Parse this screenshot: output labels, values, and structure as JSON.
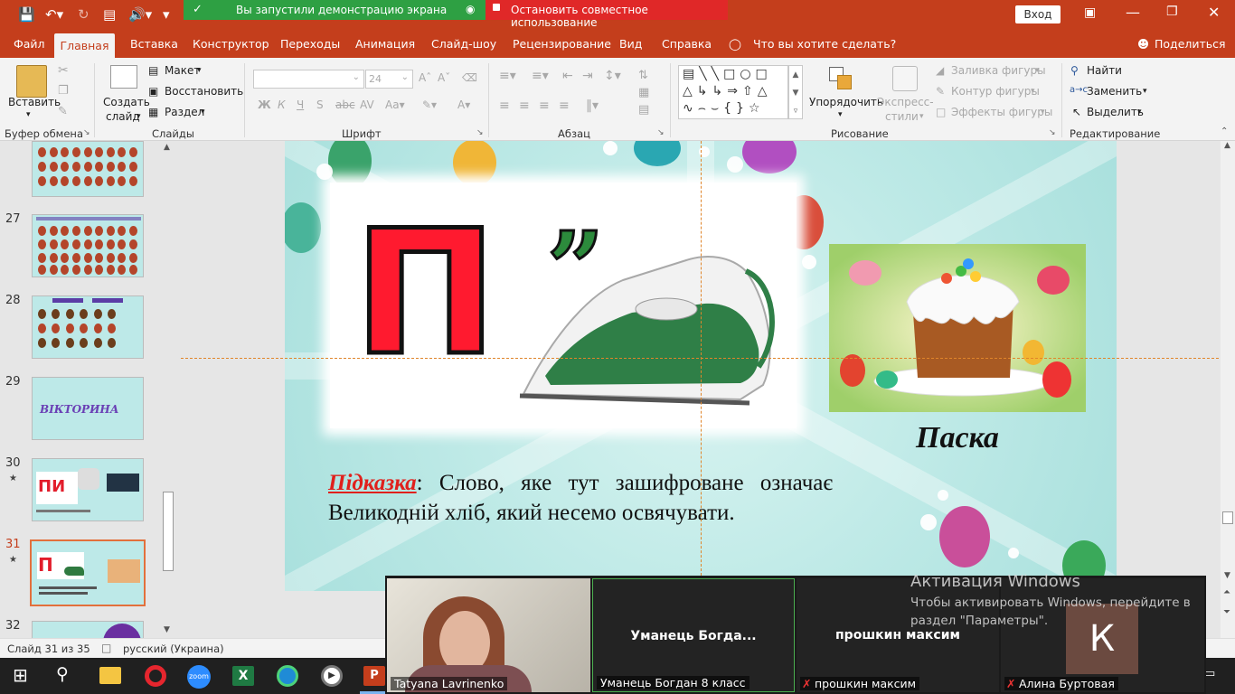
{
  "titlebar": {
    "share_banner": "Вы запустили демонстрацию экрана",
    "stop_sharing": "Остановить совместное использование",
    "login": "Вход"
  },
  "tabs": [
    "Файл",
    "Главная",
    "Вставка",
    "Конструктор",
    "Переходы",
    "Анимация",
    "Слайд-шоу",
    "Рецензирование",
    "Вид",
    "Справка"
  ],
  "tell_me": "Что вы хотите сделать?",
  "share": "Поделиться",
  "ribbon": {
    "paste": "Вставить",
    "clipboard": "Буфер обмена",
    "new_slide_1": "Создать",
    "new_slide_2": "слайд",
    "layout": "Макет",
    "reset": "Восстановить",
    "section": "Раздел",
    "slides": "Слайды",
    "font_size": "24",
    "font": "Шрифт",
    "paragraph": "Абзац",
    "arrange": "Упорядочить",
    "quick_styles_1": "Экспресс-",
    "quick_styles_2": "стили",
    "shape_fill": "Заливка фигуры",
    "shape_outline": "Контур фигуры",
    "shape_effects": "Эффекты фигуры",
    "drawing": "Рисование",
    "find": "Найти",
    "replace": "Заменить",
    "select": "Выделить",
    "editing": "Редактирование"
  },
  "thumbnails": [
    {
      "num": "27",
      "star": ""
    },
    {
      "num": "28",
      "star": ""
    },
    {
      "num": "29",
      "star": "",
      "text": "ВІКТОРИНА"
    },
    {
      "num": "30",
      "star": "★"
    },
    {
      "num": "31",
      "star": "★"
    },
    {
      "num": "32",
      "star": ""
    }
  ],
  "slide": {
    "letter": "П",
    "quote": "”",
    "caption": "Паска",
    "hint_label": "Підказка",
    "hint_text_1": ": Слово, яке тут зашифроване означає",
    "hint_text_2": "Великодній хліб, який несемо освячувати."
  },
  "status": {
    "slide_counter": "Слайд 31 из 35",
    "language": "русский (Украина)"
  },
  "zoom": {
    "tile1_name": "Tatyana Lavrinenko",
    "tile2_center": "Уманець  Богда...",
    "tile2_name": "Уманець Богдан 8 класс",
    "tile3_center": "прошкин максим",
    "tile3_name": "прошкин максим",
    "tile4_avatar": "К",
    "tile4_name": "Алина Буртовая"
  },
  "activation": {
    "title": "Активация Windows",
    "line1": "Чтобы активировать Windows, перейдите в",
    "line2": "раздел \"Параметры\"."
  }
}
